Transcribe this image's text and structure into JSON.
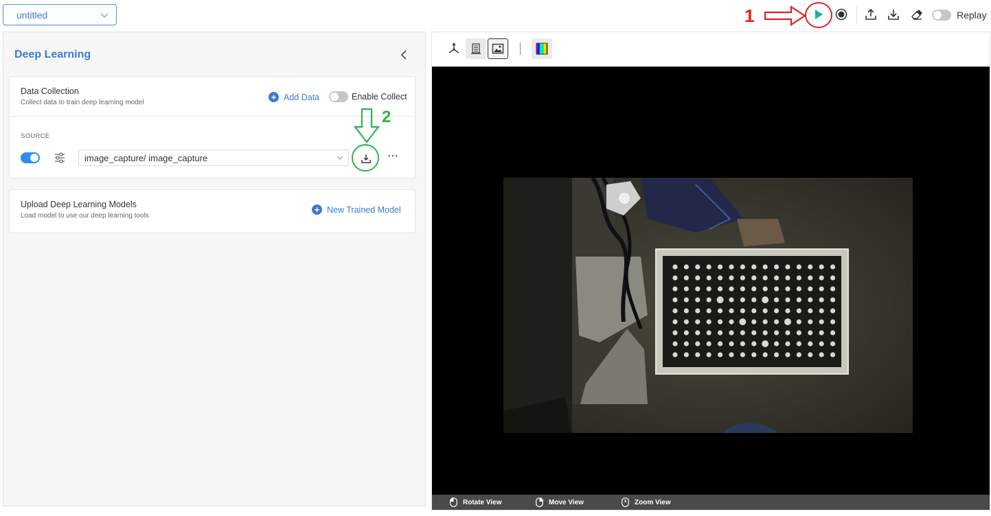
{
  "project": {
    "name": "untitled"
  },
  "toolbar": {
    "replay_label": "Replay",
    "replay_enabled": false,
    "icons": [
      "play-icon",
      "record-icon",
      "upload-icon",
      "download-icon",
      "eraser-icon"
    ]
  },
  "annotations": {
    "step1": "1",
    "step2": "2",
    "step1_color": "#e02020",
    "step2_color": "#2fb34a"
  },
  "left_panel": {
    "title": "Deep Learning",
    "data_collection": {
      "title": "Data Collection",
      "subtitle": "Collect data to train deep learning model",
      "add_data_label": "Add Data",
      "enable_collect_label": "Enable Collect",
      "enable_collect": false,
      "source_label": "SOURCE",
      "source_enabled": true,
      "source_value": "image_capture/ image_capture"
    },
    "upload_models": {
      "title": "Upload Deep Learning Models",
      "subtitle": "Load model to use our deep learning tools",
      "new_model_label": "New Trained Model"
    }
  },
  "right_panel": {
    "view_tools": [
      "axes-3d-icon",
      "point-cloud-icon",
      "image-icon",
      "colormap-icon"
    ],
    "status_hints": {
      "rotate": "Rotate View",
      "move": "Move View",
      "zoom": "Zoom View"
    }
  },
  "colors": {
    "accent": "#3a7bd5",
    "toggle_on": "#2d8cf0",
    "play_green": "#1ab394"
  }
}
